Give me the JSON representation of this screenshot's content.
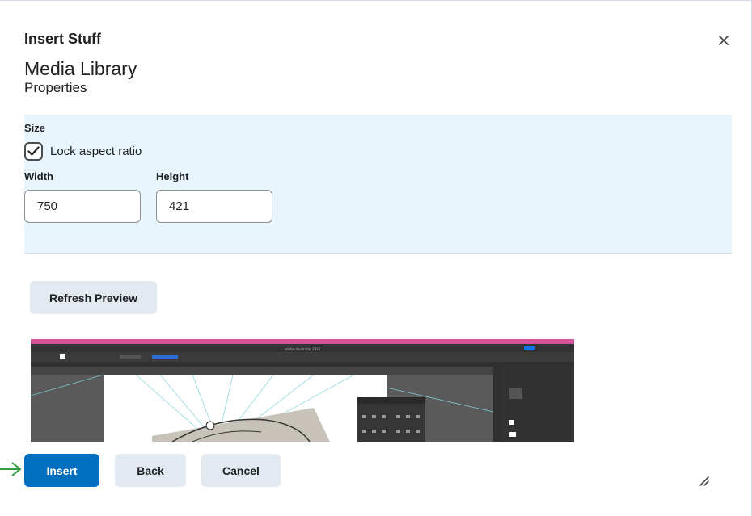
{
  "dialog": {
    "title": "Insert Stuff",
    "library_title": "Media Library",
    "properties_title": "Properties"
  },
  "size": {
    "section_label": "Size",
    "lock_aspect_label": "Lock aspect ratio",
    "lock_aspect_checked": true,
    "width_label": "Width",
    "width_value": "750",
    "height_label": "Height",
    "height_value": "421"
  },
  "preview": {
    "refresh_label": "Refresh Preview",
    "app_title": "Adobe Illustrator 2023"
  },
  "footer": {
    "insert_label": "Insert",
    "back_label": "Back",
    "cancel_label": "Cancel"
  },
  "colors": {
    "primary": "#006fbf",
    "panel_bg": "#e8f5fd",
    "secondary_btn": "#e3e9f1",
    "arrow": "#2e9e3e"
  }
}
